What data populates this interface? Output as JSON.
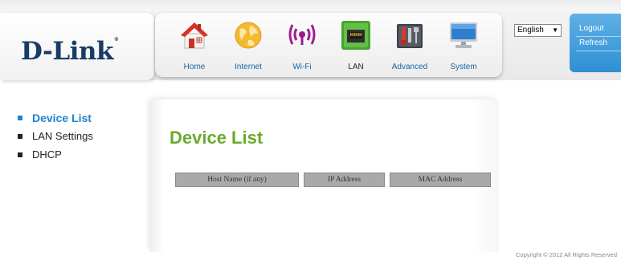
{
  "brand": {
    "logo_text": "D-Link",
    "registered_mark": "®"
  },
  "nav": {
    "items": [
      {
        "label": "Home",
        "icon": "home-icon",
        "active": false
      },
      {
        "label": "Internet",
        "icon": "globe-icon",
        "active": false
      },
      {
        "label": "Wi-Fi",
        "icon": "wifi-icon",
        "active": false
      },
      {
        "label": "LAN",
        "icon": "lan-icon",
        "active": true
      },
      {
        "label": "Advanced",
        "icon": "advanced-icon",
        "active": false
      },
      {
        "label": "System",
        "icon": "system-icon",
        "active": false
      }
    ]
  },
  "language": {
    "selected": "English",
    "arrow": "▼"
  },
  "account": {
    "logout_label": "Logout",
    "refresh_label": "Refresh"
  },
  "sidebar": {
    "items": [
      {
        "label": "Device List",
        "active": true
      },
      {
        "label": "LAN Settings",
        "active": false
      },
      {
        "label": "DHCP",
        "active": false
      }
    ]
  },
  "main": {
    "title": "Device List",
    "table": {
      "columns": [
        "Host Name (if any)",
        "IP Address",
        "MAC Address"
      ],
      "rows": []
    }
  },
  "footer": {
    "copyright": "Copyright © 2012  All Rights Reserved"
  },
  "colors": {
    "accent_blue": "#1f83cf",
    "title_green": "#6aaa2c",
    "header_blue_panel": "#3d99d9",
    "table_header_gray": "#a9a9a9"
  }
}
